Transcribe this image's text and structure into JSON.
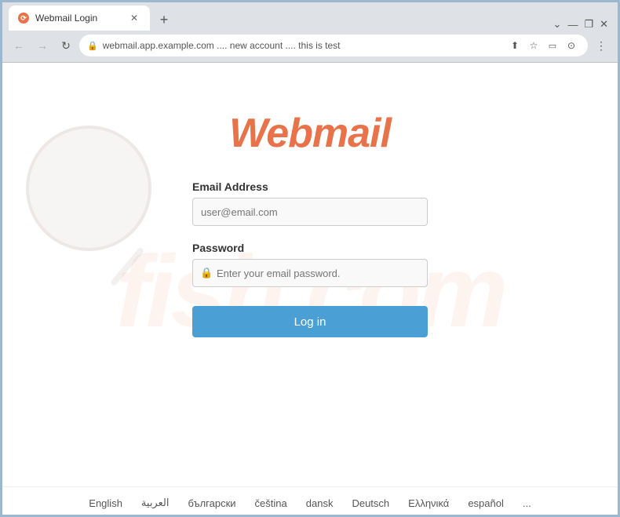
{
  "browser": {
    "tab_title": "Webmail Login",
    "new_tab_label": "+",
    "address": "https://webmail.example.com/?login",
    "address_display": "webmail.app.example.com .... new account .... this is test",
    "back_label": "←",
    "forward_label": "→",
    "reload_label": "↻",
    "chevron_label": "⌄",
    "minimize_label": "—",
    "restore_label": "❐",
    "close_label": "✕",
    "menu_label": "⋮",
    "share_icon": "⬆",
    "star_icon": "☆",
    "profile_icon": "👤",
    "person_icon": "⊙"
  },
  "page": {
    "logo_text": "Webmail",
    "watermark_text": "fish.com"
  },
  "form": {
    "email_label": "Email Address",
    "email_placeholder": "user@email.com",
    "email_value": "user@email.com",
    "password_label": "Password",
    "password_placeholder": "Enter your email password.",
    "login_button": "Log in"
  },
  "languages": {
    "items": [
      {
        "code": "en",
        "label": "English"
      },
      {
        "code": "ar",
        "label": "العربية"
      },
      {
        "code": "bg",
        "label": "български"
      },
      {
        "code": "cs",
        "label": "čeština"
      },
      {
        "code": "da",
        "label": "dansk"
      },
      {
        "code": "de",
        "label": "Deutsch"
      },
      {
        "code": "el",
        "label": "Ελληνικά"
      },
      {
        "code": "es",
        "label": "español"
      },
      {
        "code": "more",
        "label": "..."
      }
    ]
  }
}
